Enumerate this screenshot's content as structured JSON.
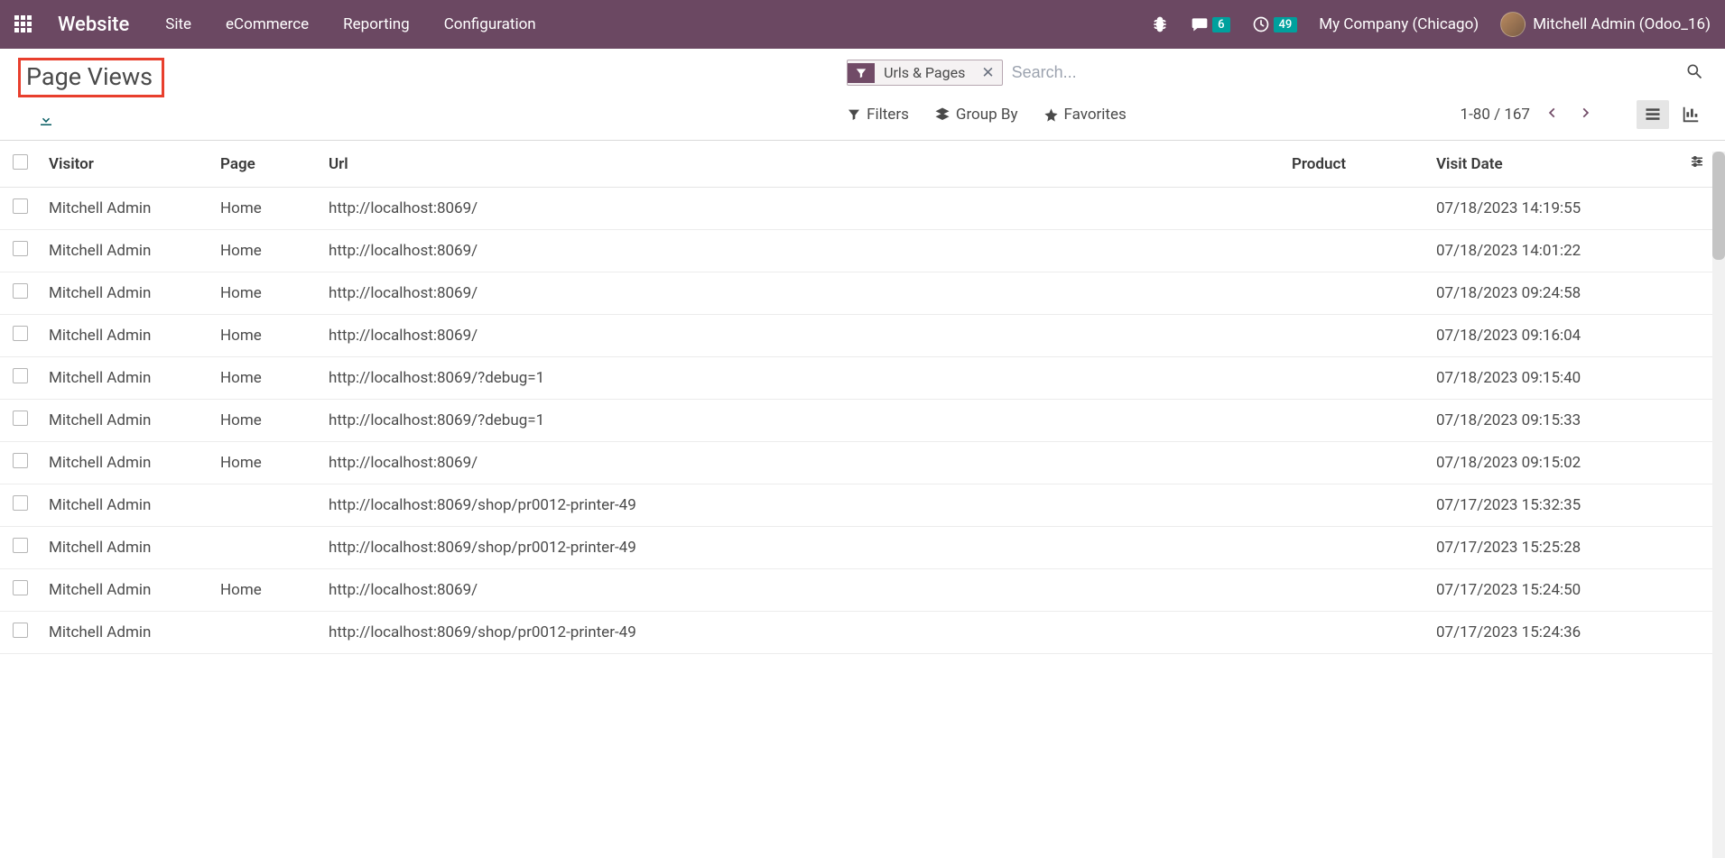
{
  "navbar": {
    "brand": "Website",
    "menu": [
      "Site",
      "eCommerce",
      "Reporting",
      "Configuration"
    ],
    "messages_badge": "6",
    "activities_badge": "49",
    "company": "My Company (Chicago)",
    "user": "Mitchell Admin (Odoo_16)"
  },
  "breadcrumb": {
    "title": "Page Views"
  },
  "search": {
    "facet_label": "Urls & Pages",
    "placeholder": "Search..."
  },
  "toolbar": {
    "filters": "Filters",
    "groupby": "Group By",
    "favorites": "Favorites",
    "pager": "1-80 / 167"
  },
  "table": {
    "headers": {
      "visitor": "Visitor",
      "page": "Page",
      "url": "Url",
      "product": "Product",
      "visit_date": "Visit Date"
    },
    "rows": [
      {
        "visitor": "Mitchell Admin",
        "page": "Home",
        "url": "http://localhost:8069/",
        "product": "",
        "date": "07/18/2023 14:19:55"
      },
      {
        "visitor": "Mitchell Admin",
        "page": "Home",
        "url": "http://localhost:8069/",
        "product": "",
        "date": "07/18/2023 14:01:22"
      },
      {
        "visitor": "Mitchell Admin",
        "page": "Home",
        "url": "http://localhost:8069/",
        "product": "",
        "date": "07/18/2023 09:24:58"
      },
      {
        "visitor": "Mitchell Admin",
        "page": "Home",
        "url": "http://localhost:8069/",
        "product": "",
        "date": "07/18/2023 09:16:04"
      },
      {
        "visitor": "Mitchell Admin",
        "page": "Home",
        "url": "http://localhost:8069/?debug=1",
        "product": "",
        "date": "07/18/2023 09:15:40"
      },
      {
        "visitor": "Mitchell Admin",
        "page": "Home",
        "url": "http://localhost:8069/?debug=1",
        "product": "",
        "date": "07/18/2023 09:15:33"
      },
      {
        "visitor": "Mitchell Admin",
        "page": "Home",
        "url": "http://localhost:8069/",
        "product": "",
        "date": "07/18/2023 09:15:02"
      },
      {
        "visitor": "Mitchell Admin",
        "page": "",
        "url": "http://localhost:8069/shop/pr0012-printer-49",
        "product": "",
        "date": "07/17/2023 15:32:35"
      },
      {
        "visitor": "Mitchell Admin",
        "page": "",
        "url": "http://localhost:8069/shop/pr0012-printer-49",
        "product": "",
        "date": "07/17/2023 15:25:28"
      },
      {
        "visitor": "Mitchell Admin",
        "page": "Home",
        "url": "http://localhost:8069/",
        "product": "",
        "date": "07/17/2023 15:24:50"
      },
      {
        "visitor": "Mitchell Admin",
        "page": "",
        "url": "http://localhost:8069/shop/pr0012-printer-49",
        "product": "",
        "date": "07/17/2023 15:24:36"
      }
    ]
  }
}
